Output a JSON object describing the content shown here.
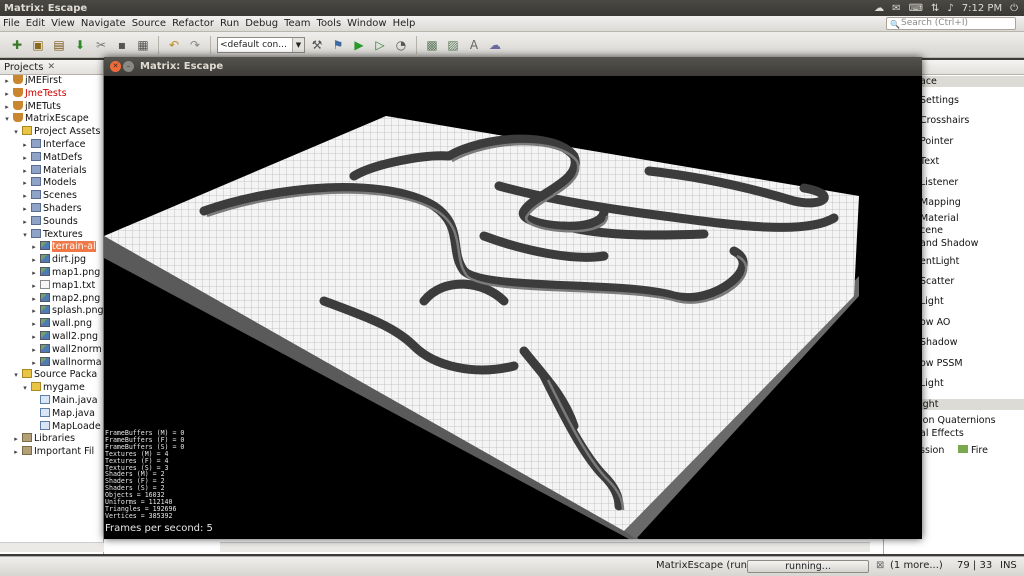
{
  "topbar": {
    "title": "Matrix: Escape",
    "time": "7:12 PM",
    "icons": [
      "cloud-icon",
      "mail-icon",
      "keyboard-icon",
      "network-icon",
      "volume-icon",
      "power-icon"
    ]
  },
  "menubar": {
    "items": [
      "File",
      "Edit",
      "View",
      "Navigate",
      "Source",
      "Refactor",
      "Run",
      "Debug",
      "Team",
      "Tools",
      "Window",
      "Help"
    ],
    "search_placeholder": "Search (Ctrl+I)"
  },
  "toolbar": {
    "config": "<default con...",
    "icons": [
      "new-file-icon",
      "new-project-icon",
      "open-project-icon",
      "download-icon",
      "clean-icon",
      "save-icon",
      "save-all-icon",
      "undo-icon",
      "redo-icon",
      "build-icon",
      "clean-build-icon",
      "run-icon",
      "debug-icon",
      "profile-icon",
      "screen-icon",
      "screen2-icon",
      "text-icon",
      "cloud-tool-icon"
    ]
  },
  "projects": {
    "tab_label": "Projects",
    "items": [
      {
        "label": "jMEFirst",
        "depth": 0,
        "icon": "cup",
        "tw": "▸"
      },
      {
        "label": "JmeTests",
        "depth": 0,
        "icon": "cup",
        "tw": "▸",
        "red": true
      },
      {
        "label": "jMETuts",
        "depth": 0,
        "icon": "cup",
        "tw": "▸"
      },
      {
        "label": "MatrixEscape",
        "depth": 0,
        "icon": "cup",
        "tw": "▾"
      },
      {
        "label": "Project Assets",
        "depth": 1,
        "icon": "pkg",
        "tw": "▾"
      },
      {
        "label": "Interface",
        "depth": 2,
        "icon": "folder",
        "tw": "▸"
      },
      {
        "label": "MatDefs",
        "depth": 2,
        "icon": "folder",
        "tw": "▸"
      },
      {
        "label": "Materials",
        "depth": 2,
        "icon": "folder",
        "tw": "▸"
      },
      {
        "label": "Models",
        "depth": 2,
        "icon": "folder",
        "tw": "▸"
      },
      {
        "label": "Scenes",
        "depth": 2,
        "icon": "folder",
        "tw": "▸"
      },
      {
        "label": "Shaders",
        "depth": 2,
        "icon": "folder",
        "tw": "▸"
      },
      {
        "label": "Sounds",
        "depth": 2,
        "icon": "folder",
        "tw": "▸"
      },
      {
        "label": "Textures",
        "depth": 2,
        "icon": "folder",
        "tw": "▾"
      },
      {
        "label": "terrain-al",
        "depth": 3,
        "icon": "img",
        "tw": "▸",
        "selected": true
      },
      {
        "label": "dirt.jpg",
        "depth": 3,
        "icon": "img",
        "tw": "▸"
      },
      {
        "label": "map1.png",
        "depth": 3,
        "icon": "img",
        "tw": "▸"
      },
      {
        "label": "map1.txt",
        "depth": 3,
        "icon": "file",
        "tw": "▸"
      },
      {
        "label": "map2.png",
        "depth": 3,
        "icon": "img",
        "tw": "▸"
      },
      {
        "label": "splash.png",
        "depth": 3,
        "icon": "img",
        "tw": "▸"
      },
      {
        "label": "wall.png",
        "depth": 3,
        "icon": "img",
        "tw": "▸"
      },
      {
        "label": "wall2.png",
        "depth": 3,
        "icon": "img",
        "tw": "▸"
      },
      {
        "label": "wall2norm",
        "depth": 3,
        "icon": "img",
        "tw": "▸"
      },
      {
        "label": "wallnorma",
        "depth": 3,
        "icon": "img",
        "tw": "▸"
      },
      {
        "label": "Source Packa",
        "depth": 1,
        "icon": "pkg",
        "tw": "▾"
      },
      {
        "label": "mygame",
        "depth": 2,
        "icon": "pkg",
        "tw": "▾"
      },
      {
        "label": "Main.java",
        "depth": 3,
        "icon": "java",
        "tw": ""
      },
      {
        "label": "Map.java",
        "depth": 3,
        "icon": "java",
        "tw": ""
      },
      {
        "label": "MapLoade",
        "depth": 3,
        "icon": "java",
        "tw": ""
      },
      {
        "label": "Libraries",
        "depth": 1,
        "icon": "lib",
        "tw": "▸"
      },
      {
        "label": "Important Fil",
        "depth": 1,
        "icon": "lib",
        "tw": "▸"
      }
    ]
  },
  "palette": {
    "items": [
      {
        "label": "ace",
        "section": true
      },
      {
        "label": "Settings"
      },
      {
        "label": "Crosshairs"
      },
      {
        "label": "Pointer"
      },
      {
        "label": "Text"
      },
      {
        "label": "Listener"
      },
      {
        "label": "Mapping"
      },
      {
        "label": "Material"
      },
      {
        "label": "cene"
      },
      {
        "label": "and Shadow"
      },
      {
        "label": "entLight"
      },
      {
        "label": "Scatter"
      },
      {
        "label": "Light"
      },
      {
        "label": "ow AO"
      },
      {
        "label": "Shadow"
      },
      {
        "label": "ow PSSM"
      },
      {
        "label": "Light"
      },
      {
        "label": "ight",
        "section": true
      },
      {
        "label": "ion Quaternions"
      },
      {
        "label": "al Effects"
      },
      {
        "label": "ssion"
      },
      {
        "label": "Fire"
      }
    ]
  },
  "game": {
    "title": "Matrix: Escape",
    "stats": [
      "FrameBuffers (M) = 0",
      "FrameBuffers (F) = 0",
      "FrameBuffers (S) = 0",
      "Textures (M) = 4",
      "Textures (F) = 4",
      "Textures (S) = 3",
      "Shaders (M) = 2",
      "Shaders (F) = 2",
      "Shaders (S) = 2",
      "Objects = 16032",
      "Uniforms = 112140",
      "Triangles = 192696",
      "Vertices = 385392"
    ],
    "fps": "Frames per second: 5"
  },
  "statusbar": {
    "run_label": "MatrixEscape (run)",
    "progress": "running...",
    "more": "(1 more...)",
    "position": "79 | 33",
    "mode": "INS"
  }
}
